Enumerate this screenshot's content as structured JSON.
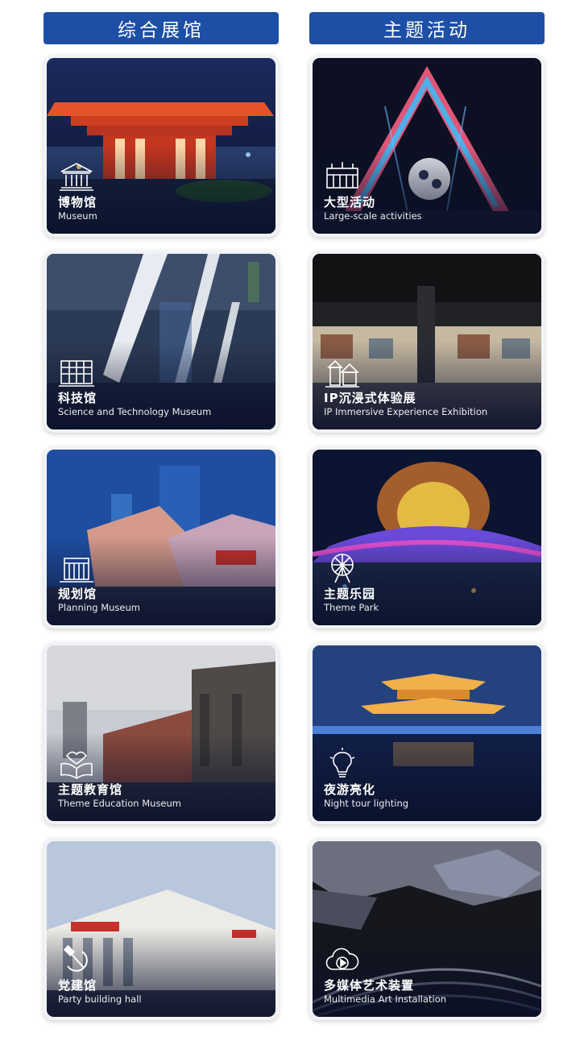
{
  "sections": [
    {
      "title": "综合展馆",
      "cards": [
        {
          "zh": "博物馆",
          "en": "Museum",
          "icon": "museum-icon"
        },
        {
          "zh": "科技馆",
          "en": "Science and Technology Museum",
          "icon": "science-building-icon"
        },
        {
          "zh": "规划馆",
          "en": "Planning Museum",
          "icon": "planning-building-icon"
        },
        {
          "zh": "主题教育馆",
          "en": "Theme Education Museum",
          "icon": "open-book-icon"
        },
        {
          "zh": "党建馆",
          "en": "Party building hall",
          "icon": "hammer-sickle-icon"
        }
      ]
    },
    {
      "title": "主题活动",
      "cards": [
        {
          "zh": "大型活动",
          "en": "Large-scale activities",
          "icon": "event-stage-icon"
        },
        {
          "zh": "IP沉浸式体验展",
          "en": "IP Immersive Experience Exhibition",
          "icon": "immersive-exhibit-icon"
        },
        {
          "zh": "主题乐园",
          "en": "Theme Park",
          "icon": "ferris-wheel-icon"
        },
        {
          "zh": "夜游亮化",
          "en": "Night tour lighting",
          "icon": "light-bulb-icon"
        },
        {
          "zh": "多媒体艺术装置",
          "en": "Multimedia Art Installation",
          "icon": "cloud-play-icon"
        }
      ]
    }
  ],
  "colors": {
    "header_bg": "#1d4fa6",
    "card_bg": "#f1f3f6",
    "text": "#ffffff"
  }
}
